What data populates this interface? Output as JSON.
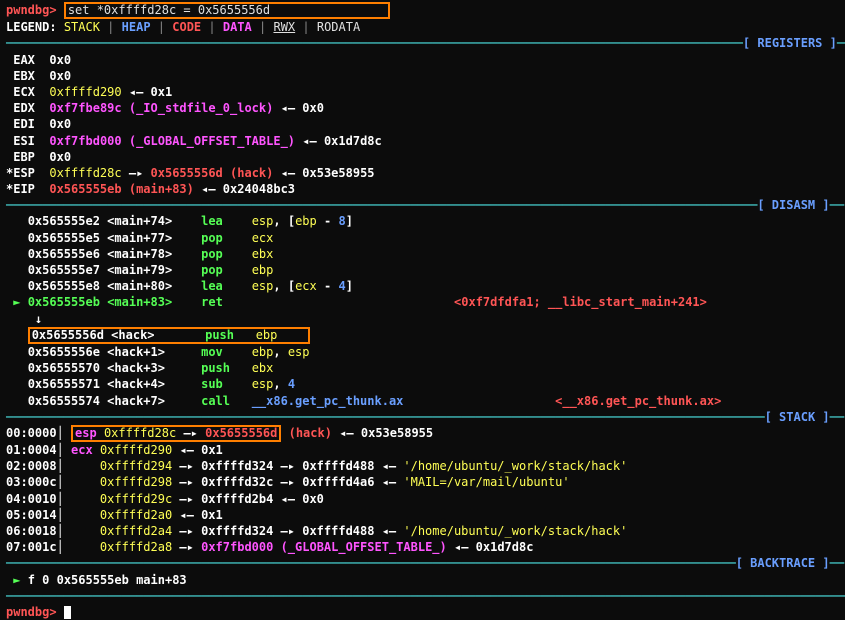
{
  "prompt": "pwndbg>",
  "command_input": "set *0xffffd28c = 0x5655556d",
  "legend": {
    "label": "LEGEND:",
    "items": [
      "STACK",
      "HEAP",
      "CODE",
      "DATA",
      "RWX",
      "RODATA"
    ]
  },
  "sections": {
    "registers": "[ REGISTERS ]",
    "disasm": "[ DISASM ]",
    "stack": "[ STACK ]",
    "backtrace": "[ BACKTRACE ]"
  },
  "registers": {
    "eax": {
      "name": "EAX",
      "val": "0x0"
    },
    "ebx": {
      "name": "EBX",
      "val": "0x0"
    },
    "ecx": {
      "name": "ECX",
      "val": "0xffffd290",
      "arrow": "◂— 0x1"
    },
    "edx": {
      "name": "EDX",
      "val": "0xf7fbe89c",
      "sym": "(_IO_stdfile_0_lock)",
      "arrow": "◂— 0x0"
    },
    "edi": {
      "name": "EDI",
      "val": "0x0"
    },
    "esi": {
      "name": "ESI",
      "val": "0xf7fbd000",
      "sym": "(_GLOBAL_OFFSET_TABLE_)",
      "arrow": "◂— 0x1d7d8c"
    },
    "ebp": {
      "name": "EBP",
      "val": "0x0"
    },
    "esp": {
      "name": "*ESP",
      "val": "0xffffd28c",
      "arrow1": "—▸ ",
      "t1": "0x5655556d",
      "sym": "(hack)",
      "arrow2": "◂— 0x53e58955"
    },
    "eip": {
      "name": "*EIP",
      "val": "0x565555eb",
      "sym": "(main+83)",
      "arrow": "◂— 0x24048bc3"
    }
  },
  "disasm": [
    {
      "a": "0x565555e2",
      "loc": "<main+74>",
      "op": "lea",
      "arg1": "esp",
      "arg2": ", [",
      "arg3": "ebp",
      "arg4": " - ",
      "arg5": "8",
      "arg6": "]"
    },
    {
      "a": "0x565555e5",
      "loc": "<main+77>",
      "op": "pop",
      "arg1": "ecx"
    },
    {
      "a": "0x565555e6",
      "loc": "<main+78>",
      "op": "pop",
      "arg1": "ebx"
    },
    {
      "a": "0x565555e7",
      "loc": "<main+79>",
      "op": "pop",
      "arg1": "ebp"
    },
    {
      "a": "0x565555e8",
      "loc": "<main+80>",
      "op": "lea",
      "arg1": "esp",
      "arg2": ", [",
      "arg3": "ecx",
      "arg4": " - ",
      "arg5": "4",
      "arg6": "]"
    },
    {
      "a": "0x565555eb",
      "loc": "<main+83>",
      "op": "ret",
      "target": "<0xf7dfdfa1; __libc_start_main+241>"
    },
    {
      "a": "0x5655556d",
      "loc": "<hack>",
      "op": "push",
      "arg1": "ebp"
    },
    {
      "a": "0x5655556e",
      "loc": "<hack+1>",
      "op": "mov",
      "arg1": "ebp",
      "arg4": ", ",
      "arg3": "esp"
    },
    {
      "a": "0x56555570",
      "loc": "<hack+3>",
      "op": "push",
      "arg1": "ebx"
    },
    {
      "a": "0x56555571",
      "loc": "<hack+4>",
      "op": "sub",
      "arg1": "esp",
      "arg4": ", ",
      "arg5": "4"
    },
    {
      "a": "0x56555574",
      "loc": "<hack+7>",
      "op": "call",
      "fn": "__x86.get_pc_thunk.ax",
      "target": "<__x86.get_pc_thunk.ax>"
    }
  ],
  "down_arrow": "↓",
  "ret_arrow": "►",
  "stack": [
    {
      "off": "00:0000│",
      "reg": "esp",
      "a": "0xffffd28c",
      "t1": "—▸ ",
      "v1": "0x5655556d",
      "sym": "(hack)",
      "tail": "◂— 0x53e58955"
    },
    {
      "off": "01:0004│",
      "reg": "ecx",
      "a": "0xffffd290",
      "tail": "◂— 0x1"
    },
    {
      "off": "02:0008│",
      "a": "0xffffd294",
      "chain": "—▸ 0xffffd324 —▸ 0xffffd488 ◂— ",
      "str": "'/home/ubuntu/_work/stack/hack'"
    },
    {
      "off": "03:000c│",
      "a": "0xffffd298",
      "chain": "—▸ 0xffffd32c —▸ 0xffffd4a6 ◂— ",
      "str": "'MAIL=/var/mail/ubuntu'"
    },
    {
      "off": "04:0010│",
      "a": "0xffffd29c",
      "chain": "—▸ 0xffffd2b4 ◂— 0x0"
    },
    {
      "off": "05:0014│",
      "a": "0xffffd2a0",
      "tail": "◂— 0x1"
    },
    {
      "off": "06:0018│",
      "a": "0xffffd2a4",
      "chain": "—▸ 0xffffd324 —▸ 0xffffd488 ◂— ",
      "str": "'/home/ubuntu/_work/stack/hack'"
    },
    {
      "off": "07:001c│",
      "a": "0xffffd2a8",
      "chain": "—▸ ",
      "v1": "0xf7fbd000",
      "sym": "(_GLOBAL_OFFSET_TABLE_)",
      "tail": "◂— 0x1d7d8c"
    }
  ],
  "backtrace": {
    "arrow": "►",
    "text": "f 0 0x565555eb main+83"
  }
}
